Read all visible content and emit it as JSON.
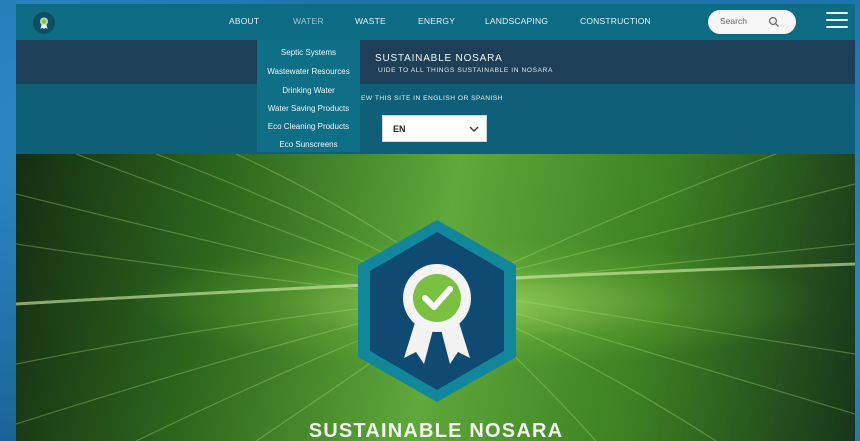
{
  "nav": {
    "items": [
      {
        "label": "ABOUT",
        "active": false
      },
      {
        "label": "WATER",
        "active": true
      },
      {
        "label": "WASTE",
        "active": false
      },
      {
        "label": "ENERGY",
        "active": false
      },
      {
        "label": "LANDSCAPING",
        "active": false
      },
      {
        "label": "CONSTRUCTION",
        "active": false
      }
    ],
    "search_placeholder": "Search",
    "icons": {
      "logo": "award-icon",
      "search": "search-icon",
      "menu": "hamburger-menu-icon"
    }
  },
  "dropdown": {
    "items": [
      "Septic Systems",
      "Wastewater Resources",
      "Drinking Water",
      "Water Saving Products",
      "Eco Cleaning Products",
      "Eco Sunscreens"
    ]
  },
  "header": {
    "title": "SUSTAINABLE NOSARA",
    "subtitle": "UIDE TO ALL THINGS SUSTAINABLE IN NOSARA"
  },
  "language": {
    "label": "EW THIS SITE IN ENGLISH OR SPANISH",
    "selected": "EN"
  },
  "hero": {
    "title": "SUSTAINABLE NOSARA",
    "badge_icon": "award-ribbon-check-icon"
  },
  "colors": {
    "nav_bg": "#0d6c84",
    "header_bg": "#1d3f57",
    "lang_bg": "#0f5f79",
    "badge_teal": "#12879b",
    "badge_navy": "#0f4a73",
    "check_green": "#7ac142"
  }
}
